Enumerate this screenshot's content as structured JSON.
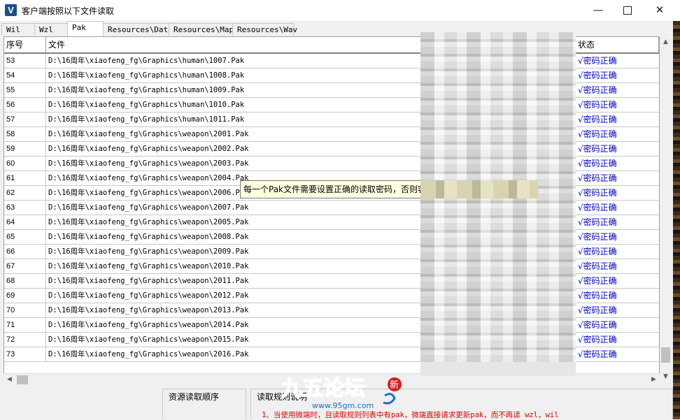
{
  "window": {
    "title": "客户端按照以下文件读取",
    "app_icon_letter": "V",
    "controls": {
      "minimize": "—",
      "maximize": "",
      "close": "✕"
    }
  },
  "tabs": [
    {
      "label": "Wil",
      "active": false
    },
    {
      "label": "Wzl",
      "active": false
    },
    {
      "label": "Pak",
      "active": true
    },
    {
      "label": "Resources\\Data",
      "active": false
    },
    {
      "label": "Resources\\Map",
      "active": false
    },
    {
      "label": "Resources\\Wav",
      "active": false
    }
  ],
  "table": {
    "headers": {
      "no": "序号",
      "file": "文件",
      "status": "状态"
    },
    "rows": [
      {
        "no": "53",
        "file": "D:\\16周年\\xiaofeng_fg\\Graphics\\human\\1007.Pak",
        "status": "√密码正确"
      },
      {
        "no": "54",
        "file": "D:\\16周年\\xiaofeng_fg\\Graphics\\human\\1008.Pak",
        "status": "√密码正确"
      },
      {
        "no": "55",
        "file": "D:\\16周年\\xiaofeng_fg\\Graphics\\human\\1009.Pak",
        "status": "√密码正确"
      },
      {
        "no": "56",
        "file": "D:\\16周年\\xiaofeng_fg\\Graphics\\human\\1010.Pak",
        "status": "√密码正确"
      },
      {
        "no": "57",
        "file": "D:\\16周年\\xiaofeng_fg\\Graphics\\human\\1011.Pak",
        "status": "√密码正确"
      },
      {
        "no": "58",
        "file": "D:\\16周年\\xiaofeng_fg\\Graphics\\weapon\\2001.Pak",
        "status": "√密码正确"
      },
      {
        "no": "59",
        "file": "D:\\16周年\\xiaofeng_fg\\Graphics\\weapon\\2002.Pak",
        "status": "√密码正确"
      },
      {
        "no": "60",
        "file": "D:\\16周年\\xiaofeng_fg\\Graphics\\weapon\\2003.Pak",
        "status": "√密码正确"
      },
      {
        "no": "61",
        "file": "D:\\16周年\\xiaofeng_fg\\Graphics\\weapon\\2004.Pak",
        "status": "√密码正确"
      },
      {
        "no": "62",
        "file": "D:\\16周年\\xiaofeng_fg\\Graphics\\weapon\\2006.Pak",
        "status": "√密码正确"
      },
      {
        "no": "63",
        "file": "D:\\16周年\\xiaofeng_fg\\Graphics\\weapon\\2007.Pak",
        "status": "√密码正确"
      },
      {
        "no": "64",
        "file": "D:\\16周年\\xiaofeng_fg\\Graphics\\weapon\\2005.Pak",
        "status": "√密码正确"
      },
      {
        "no": "65",
        "file": "D:\\16周年\\xiaofeng_fg\\Graphics\\weapon\\2008.Pak",
        "status": "√密码正确"
      },
      {
        "no": "66",
        "file": "D:\\16周年\\xiaofeng_fg\\Graphics\\weapon\\2009.Pak",
        "status": "√密码正确"
      },
      {
        "no": "67",
        "file": "D:\\16周年\\xiaofeng_fg\\Graphics\\weapon\\2010.Pak",
        "status": "√密码正确"
      },
      {
        "no": "68",
        "file": "D:\\16周年\\xiaofeng_fg\\Graphics\\weapon\\2011.Pak",
        "status": "√密码正确"
      },
      {
        "no": "69",
        "file": "D:\\16周年\\xiaofeng_fg\\Graphics\\weapon\\2012.Pak",
        "status": "√密码正确"
      },
      {
        "no": "70",
        "file": "D:\\16周年\\xiaofeng_fg\\Graphics\\weapon\\2013.Pak",
        "status": "√密码正确"
      },
      {
        "no": "71",
        "file": "D:\\16周年\\xiaofeng_fg\\Graphics\\weapon\\2014.Pak",
        "status": "√密码正确"
      },
      {
        "no": "72",
        "file": "D:\\16周年\\xiaofeng_fg\\Graphics\\weapon\\2015.Pak",
        "status": "√密码正确"
      },
      {
        "no": "73",
        "file": "D:\\16周年\\xiaofeng_fg\\Graphics\\weapon\\2016.Pak",
        "status": "√密码正确"
      }
    ]
  },
  "tooltip": {
    "text": "每一个Pak文件需要设置正确的读取密码，否则客"
  },
  "bottom": {
    "panel1_title": "资源读取顺序",
    "panel2_title": "读取规则说明",
    "rule_line": "1、当使用微端时，且读取规则列表中有pak，微端直接请求更新pak，而不再读 wzl，wil"
  },
  "watermark": {
    "text": "九五论坛",
    "url": "www.95gm.com",
    "badge": "新"
  },
  "colors": {
    "status_text": "#0000c8",
    "rule_text": "#e00000",
    "tooltip_bg": "#ffffe1"
  },
  "icons": {
    "app": "app-v-icon",
    "minimize": "minimize-icon",
    "maximize": "maximize-icon",
    "close": "close-icon"
  }
}
